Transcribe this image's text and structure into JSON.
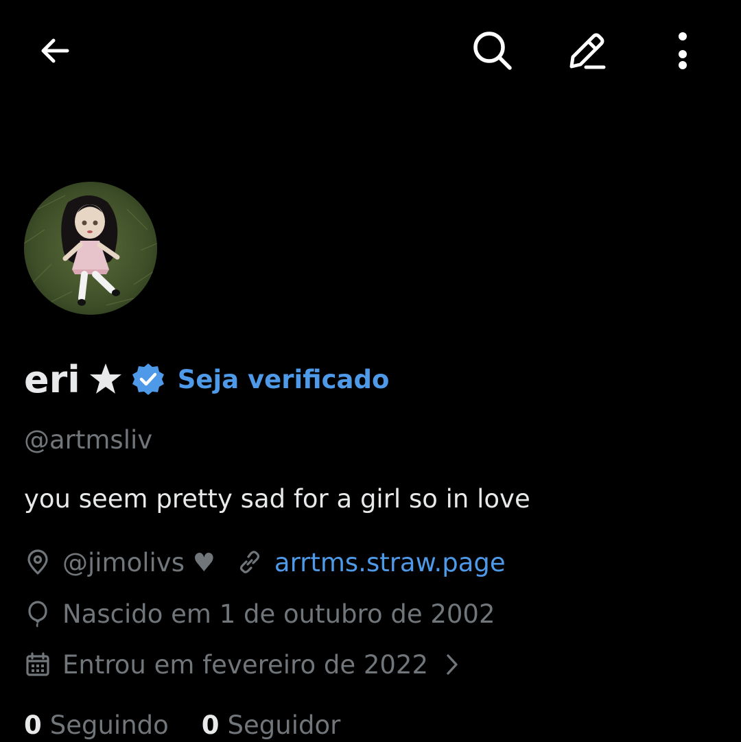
{
  "topbar": {
    "back_icon": "arrow-left-icon",
    "search_icon": "search-icon",
    "edit_icon": "pencil-icon",
    "more_icon": "more-vertical-icon"
  },
  "profile": {
    "avatar_icon": "doll-photo",
    "display_name": "eri",
    "name_symbol": "★",
    "verified_icon": "verified-badge-icon",
    "get_verified_label": "Seja verificado",
    "handle": "@artmsliv",
    "bio": "you seem pretty sad for a girl so in love",
    "location": "@jimolivs ♥",
    "website": "arrtms.straw.page",
    "birth": "Nascido em 1 de outubro de 2002",
    "joined": "Entrou em fevereiro de 2022"
  },
  "stats": {
    "following_count": "0",
    "following_label": "Seguindo",
    "followers_count": "0",
    "followers_label": "Seguidor"
  },
  "colors": {
    "background": "#000000",
    "primary_text": "#e7e9ea",
    "secondary_text": "#71767b",
    "accent": "#4e9ae8"
  }
}
